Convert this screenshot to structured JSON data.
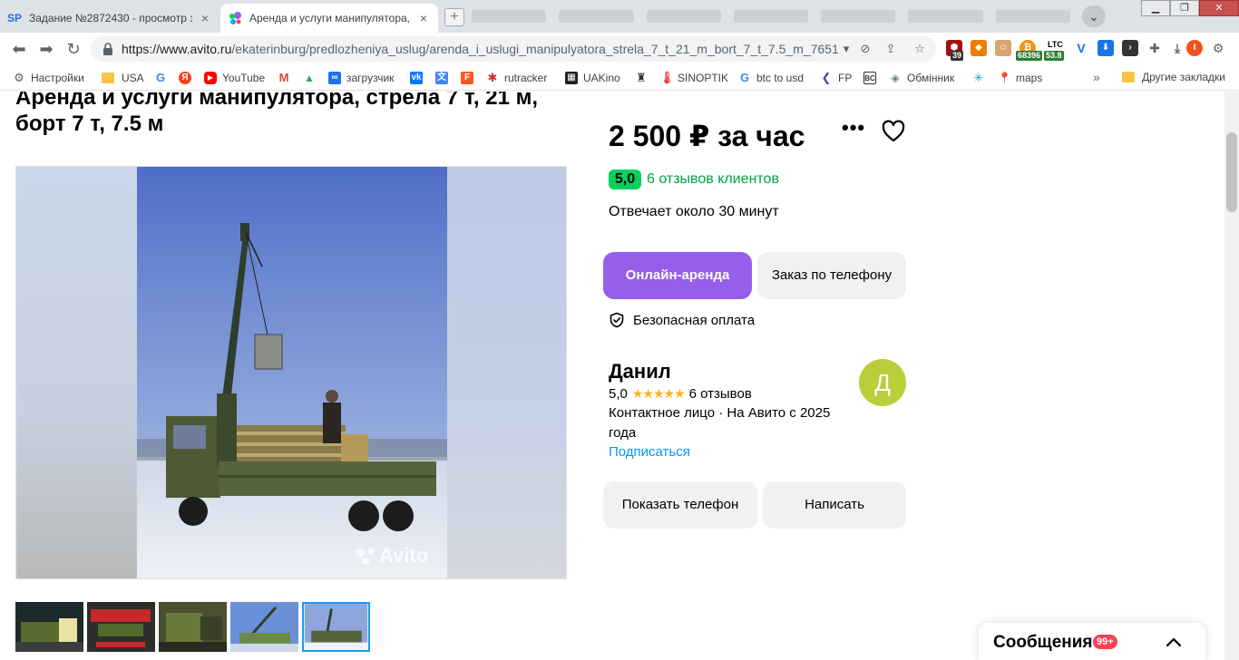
{
  "browser": {
    "tabs": [
      {
        "title": "Задание №2872430 - просмотр з",
        "favicon_text": "SP",
        "active": false
      },
      {
        "title": "Аренда и услуги манипулятора, с",
        "active": true
      }
    ],
    "url_domain": "https://www.avito.ru",
    "url_path": "/ekaterinburg/predlozheniya_uslug/arenda_i_uslugi_manipulyatora_strela_7_t_21_m_bort_7_t_7.5_m_76516...",
    "extensions": {
      "badge_39": "39",
      "btc_value": "68396",
      "ltc_label": "LTC",
      "ltc_value": "53.8",
      "avatar_letter": "I"
    },
    "bookmarks": [
      {
        "label": "Настройки",
        "icon": "gear-icon",
        "color": "#5f6368"
      },
      {
        "label": "USA",
        "icon": "folder-icon",
        "color": "#f6c544"
      },
      {
        "label": "",
        "icon": "google-icon",
        "color": "#4285f4"
      },
      {
        "label": "",
        "icon": "yandex-icon",
        "color": "#fc3f1d"
      },
      {
        "label": "YouTube",
        "icon": "youtube-icon",
        "color": "#ff0000"
      },
      {
        "label": "",
        "icon": "gmail-icon",
        "color": "#ea4335"
      },
      {
        "label": "",
        "icon": "drive-icon",
        "color": "#34a853"
      },
      {
        "label": "загрузчик",
        "icon": "infinity-icon",
        "color": "#1a73e8"
      },
      {
        "label": "",
        "icon": "vk-icon",
        "color": "#0077ff"
      },
      {
        "label": "",
        "icon": "translate-icon",
        "color": "#4285f4"
      },
      {
        "label": "",
        "icon": "f-icon",
        "color": "#ff5722"
      },
      {
        "label": "rutracker",
        "icon": "rutracker-icon",
        "color": "#d32f2f"
      },
      {
        "label": "UAKino",
        "icon": "uakino-icon",
        "color": "#222222"
      },
      {
        "label": "",
        "icon": "person-icon",
        "color": "#333333"
      },
      {
        "label": "SINOPTIK",
        "icon": "thermometer-icon",
        "color": "#e53935"
      },
      {
        "label": "btc to usd",
        "icon": "google-icon",
        "color": "#4285f4"
      },
      {
        "label": "FP",
        "icon": "fp-icon",
        "color": "#3f51b5"
      },
      {
        "label": "",
        "icon": "bc-icon",
        "color": "#333333"
      },
      {
        "label": "Обмінник",
        "icon": "exchange-icon",
        "color": "#607d8b"
      },
      {
        "label": "",
        "icon": "star-icon",
        "color": "#03a9f4"
      },
      {
        "label": "maps",
        "icon": "maps-icon",
        "color": "#34a853"
      }
    ],
    "bookmarks_more": "»",
    "bookmarks_other": "Другие закладки"
  },
  "listing": {
    "title": "Аренда и услуги манипулятора, стрела 7 т, 21 м, борт 7 т, 7.5 м",
    "price": "2 500 ₽ за час",
    "more_label": "•••",
    "rating": "5,0",
    "reviews_text": "6 отзывов клиентов",
    "reply_time": "Отвечает около 30 минут",
    "online_rent_label": "Онлайн-аренда",
    "phone_order_label": "Заказ по телефону",
    "safe_payment": "Безопасная оплата",
    "photo_watermark": "Avito",
    "thumbnail_count": 5,
    "active_thumbnail": 5
  },
  "seller": {
    "name": "Данил",
    "rating": "5,0",
    "stars": "★★★★★",
    "reviews": "6 отзывов",
    "info": "Контактное лицо · На Авито с 2025 года",
    "subscribe": "Подписаться",
    "avatar_letter": "Д",
    "avatar_color": "#bacd3b",
    "show_phone_label": "Показать телефон",
    "write_label": "Написать"
  },
  "messages": {
    "label": "Сообщения",
    "badge": "99+"
  },
  "colors": {
    "primary_button": "#965eeb",
    "rating_green": "#02d15c",
    "reviews_link": "#00a046",
    "subscribe_link": "#0099f7",
    "star": "#ffb021",
    "badge_red": "#ff4053"
  }
}
